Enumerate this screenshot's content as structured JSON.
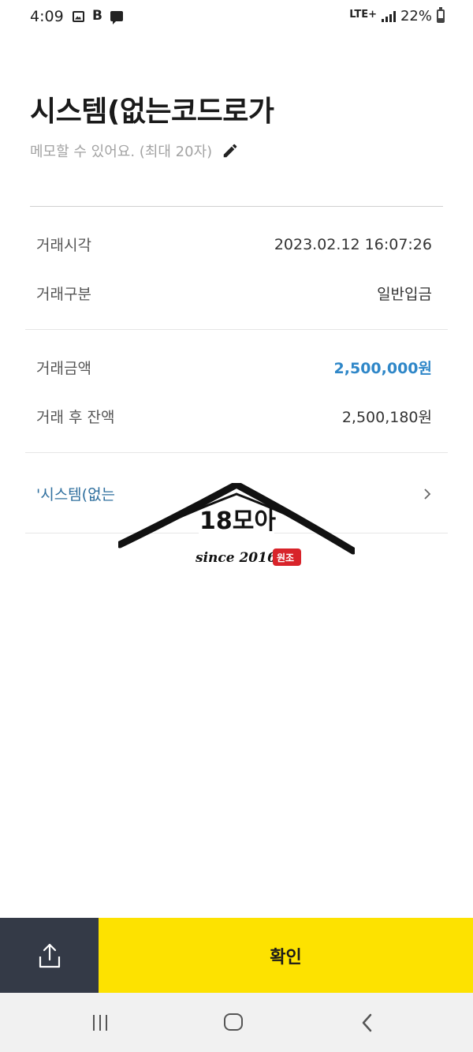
{
  "status_bar": {
    "time": "4:09",
    "network": "LTE+",
    "battery": "22%"
  },
  "header": {
    "title": "시스템(없는코드로가",
    "memo_placeholder": "메모할 수 있어요. (최대 20자)"
  },
  "details": [
    {
      "label": "거래시각",
      "value": "2023.02.12 16:07:26"
    },
    {
      "label": "거래구분",
      "value": "일반입금"
    },
    {
      "label": "거래금액",
      "value": "2,500,000원"
    },
    {
      "label": "거래 후 잔액",
      "value": "2,500,180원"
    }
  ],
  "link_row": {
    "label": "'시스템(없는"
  },
  "watermark": {
    "brand": "18모아",
    "since": "since 2016",
    "badge": "원조"
  },
  "actions": {
    "confirm_label": "확인"
  },
  "colors": {
    "accent_amount": "#2f87c8",
    "confirm_bg": "#fde200",
    "share_bg": "#343a47"
  },
  "icons": [
    "photo-icon",
    "b-icon",
    "chat-icon",
    "signal-icon",
    "battery-icon",
    "pencil-icon",
    "chevron-right-icon",
    "share-icon",
    "nav-recent-icon",
    "nav-home-icon",
    "nav-back-icon"
  ]
}
